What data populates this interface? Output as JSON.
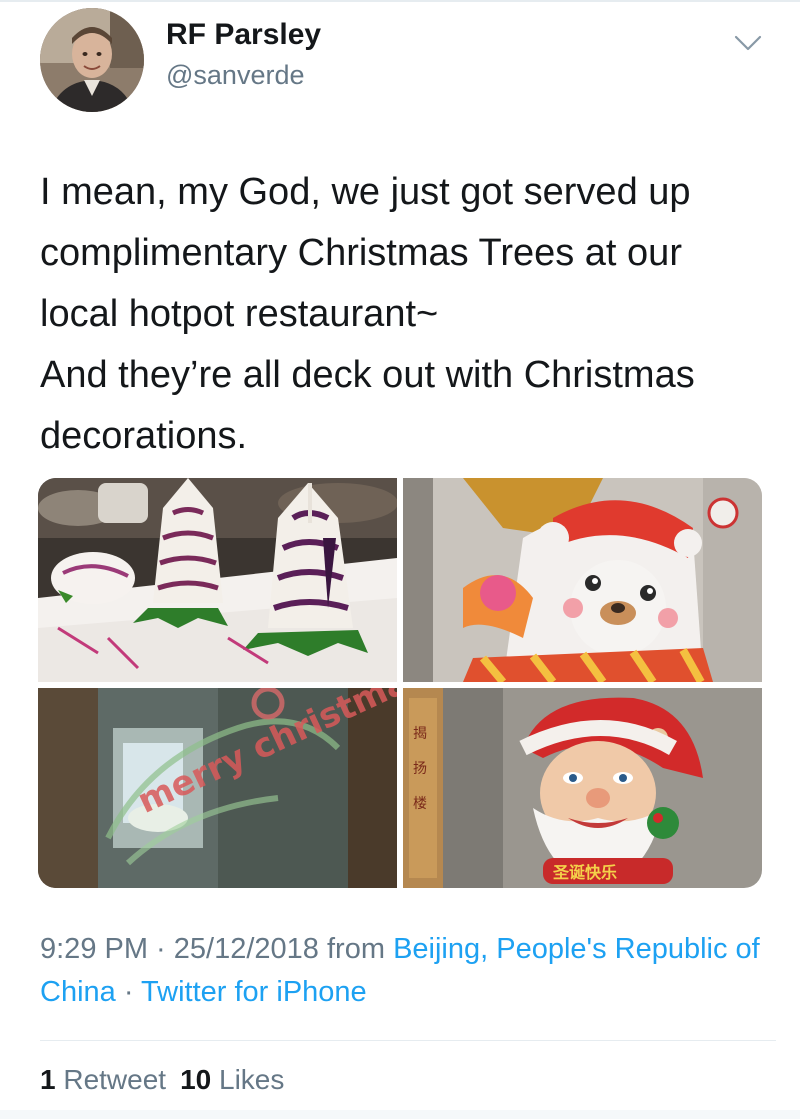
{
  "user": {
    "display_name": "RF Parsley",
    "handle": "@sanverde"
  },
  "tweet": {
    "lines": [
      "I mean, my God, we just got served up",
      "complimentary Christmas Trees at our",
      "local hotpot restaurant~",
      "And they’re all deck out with Christmas",
      "decorations."
    ]
  },
  "photo_text": {
    "window_decal": "merry christmas",
    "sign_chars": [
      "揭",
      "扬",
      "楼"
    ],
    "santa_banner": "圣诞快乐"
  },
  "meta": {
    "time": "9:29 PM",
    "sep1": " · ",
    "date": "25/12/2018",
    "from": " from ",
    "location": "Beijing, People's Republic of China",
    "sep2": " · ",
    "client": "Twitter for iPhone"
  },
  "stats": {
    "retweet_count": "1",
    "retweet_label": "Retweet",
    "like_count": "10",
    "like_label": "Likes"
  },
  "icons": {
    "menu": "chevron-down-icon"
  },
  "colors": {
    "link": "#1da1f2",
    "secondary_text": "#657786",
    "primary_text": "#14171a"
  }
}
